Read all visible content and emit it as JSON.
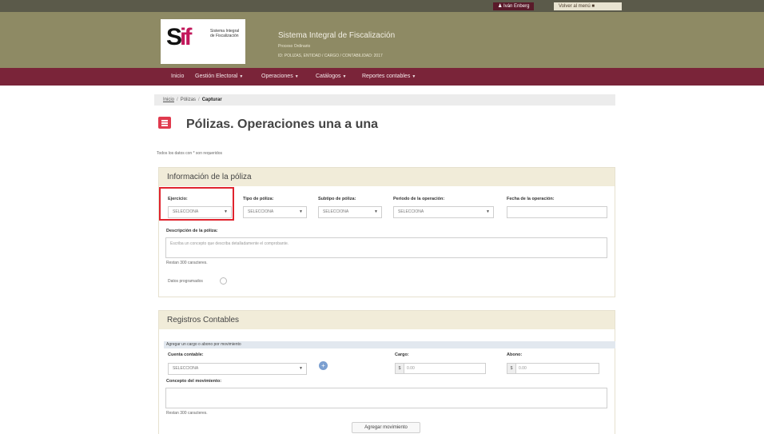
{
  "topbar": {
    "user_label": "Iván Enberg",
    "back_label": "Volver al menú"
  },
  "header": {
    "logo_text": "Sistema Integral de Fiscalización",
    "title": "Sistema Integral de Fiscalización",
    "subtitle1": "Proceso Ordinario",
    "subtitle2": "ID: POLIZAS, ENTIDAD / CARGO / CONTABILIDAD: 2017"
  },
  "nav": [
    {
      "label": "Inicio"
    },
    {
      "label": "Gestión Electoral"
    },
    {
      "label": "Operaciones"
    },
    {
      "label": "Catálogos"
    },
    {
      "label": "Reportes contables"
    }
  ],
  "breadcrumb": {
    "home": "Inicio",
    "section": "Pólizas",
    "current": "Capturar"
  },
  "page": {
    "title": "Pólizas. Operaciones una a una",
    "required_note": "Todos los datos con * son requeridos"
  },
  "poliza_panel": {
    "heading": "Información de la póliza",
    "fields": {
      "ejercicio": {
        "label": "Ejercicio:",
        "value": "SELECCIONA"
      },
      "tipo": {
        "label": "Tipo de póliza:",
        "value": "SELECCIONA"
      },
      "subtipo": {
        "label": "Subtipo de póliza:",
        "value": "SELECCIONA"
      },
      "periodo": {
        "label": "Periodo de la operación:",
        "value": "SELECCIONA"
      },
      "fecha": {
        "label": "Fecha de la operación:",
        "value": ""
      }
    },
    "descripcion_label": "Descripción de la póliza:",
    "descripcion_placeholder": "Escriba un concepto que describa detalladamente el comprobante.",
    "descripcion_counter": "Restan 300 caracteres.",
    "toggle_label": "Datos programados"
  },
  "registros_panel": {
    "heading": "Registros Contables",
    "subheading": "Agregar un cargo o abono por movimiento",
    "cuenta_label": "Cuenta contable:",
    "cuenta_value": "SELECCIONA",
    "cargo_label": "Cargo:",
    "cargo_placeholder": "0.00",
    "abono_label": "Abono:",
    "abono_placeholder": "0.00",
    "currency": "$",
    "concepto_label": "Concepto del movimiento:",
    "concepto_counter": "Restan 300 caracteres.",
    "add_button": "Agregar movimiento"
  }
}
